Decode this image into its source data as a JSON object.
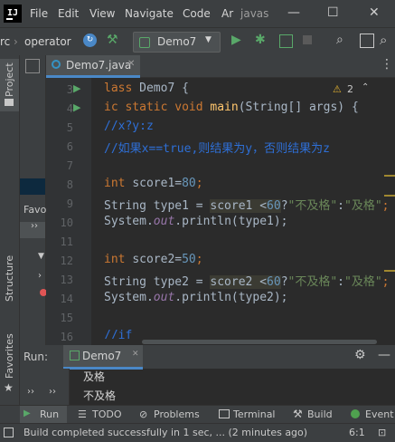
{
  "titlebar": {
    "logo": "IJ",
    "menus": [
      "File",
      "Edit",
      "View",
      "Navigate",
      "Code",
      "Ar"
    ],
    "project_name": "javas",
    "minimize": "—",
    "maximize": "☐",
    "close": "✕"
  },
  "navbar": {
    "crumb1": "rc",
    "crumb2": "operator",
    "run_config": "Demo7"
  },
  "sidebar": {
    "project_label": "Project",
    "structure_label": "Structure",
    "favorites_label": "Favorites",
    "favo_label": "Favo"
  },
  "editor": {
    "tab_label": "Demo7.java",
    "warning_count": "2",
    "line_numbers": [
      "3",
      "4",
      "5",
      "6",
      "7",
      "8",
      "9",
      "10",
      "11",
      "12",
      "13",
      "14",
      "15",
      "16"
    ],
    "lines": {
      "l3a": "lass ",
      "l3b": "Demo7 {",
      "l4a": "ic static void ",
      "l4b": "main",
      "l4c": "(String[] args) {",
      "l5": "//x?y:z",
      "l6": "//如果x==true,则结果为y，否则结果为z",
      "l8a": "int ",
      "l8b": "score1=",
      "l8c": "80",
      "l8d": ";",
      "l9a": "String type1 = ",
      "l9b": "score1 <",
      "l9c": "60",
      "l9d": "?",
      "l9e": "\"不及格\"",
      "l9f": ":",
      "l9g": "\"及格\"",
      "l9h": ";",
      "l10a": "System.",
      "l10b": "out",
      "l10c": ".println(type1);",
      "l12a": "int ",
      "l12b": "score2=",
      "l12c": "50",
      "l12d": ";",
      "l13a": "String type2 = ",
      "l13b": "score2 <",
      "l13c": "60",
      "l13d": "?",
      "l13e": "\"不及格\"",
      "l13f": ":",
      "l13g": "\"及格\"",
      "l13h": ";",
      "l14a": "System.",
      "l14b": "out",
      "l14c": ".println(type2);",
      "l16": "//if"
    }
  },
  "run_panel": {
    "title": "Run:",
    "tab": "Demo7",
    "output": [
      "及格",
      "不及格"
    ]
  },
  "bottom_tabs": {
    "run": "Run",
    "todo": "TODO",
    "problems": "Problems",
    "terminal": "Terminal",
    "build": "Build",
    "event": "Event"
  },
  "status": {
    "message": "Build completed successfully in 1 sec, ... (2 minutes ago)",
    "position": "6:1"
  },
  "colors": {
    "accent": "#4a88c7",
    "run_green": "#59a869",
    "background": "#2b2b2b"
  }
}
